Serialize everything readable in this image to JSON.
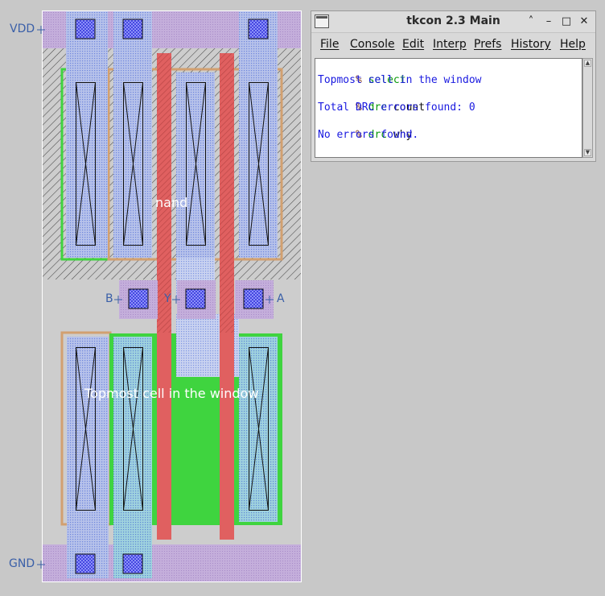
{
  "layout": {
    "pins": {
      "vdd": "VDD",
      "gnd": "GND",
      "b": "B",
      "y": "Y",
      "a": "A"
    },
    "cell_name": "nand",
    "selection_label": "Topmost cell in the window",
    "colors": {
      "background": "#c8c8c8",
      "cell_boundary": "#ffffff",
      "metal1": "#c0a6d8",
      "poly": "#e06666",
      "ndiff": "#3fd43f",
      "pdiff_outline": "#d2a070",
      "contact": "#2d2dd8",
      "local_interconnect": "#a8b8e8",
      "pin_label": "#3a5fa8"
    },
    "icons": {
      "pin_tick": "pin-tick-icon",
      "contact_cut": "contact-cut-icon"
    }
  },
  "tkcon": {
    "title": "tkcon 2.3 Main",
    "window_buttons": {
      "shade": "˄",
      "minimize": "–",
      "maximize": "□",
      "close": "✕"
    },
    "menus": [
      "File",
      "Console",
      "Edit",
      "Interp",
      "Prefs",
      "History",
      "Help"
    ],
    "console_lines": [
      {
        "kind": "cmd",
        "prompt": "% ",
        "cmd": "select",
        "arg": ""
      },
      {
        "kind": "out",
        "text": "Topmost cell in the window"
      },
      {
        "kind": "cmd",
        "prompt": "% ",
        "cmd": "drc",
        "arg": " count"
      },
      {
        "kind": "out",
        "text": "Total DRC errors found: 0"
      },
      {
        "kind": "cmd",
        "prompt": "% ",
        "cmd": "drc",
        "arg": " why"
      },
      {
        "kind": "out",
        "text": "No errors found."
      },
      {
        "kind": "cmd",
        "prompt": "% ",
        "cmd": "",
        "arg": ""
      }
    ]
  }
}
